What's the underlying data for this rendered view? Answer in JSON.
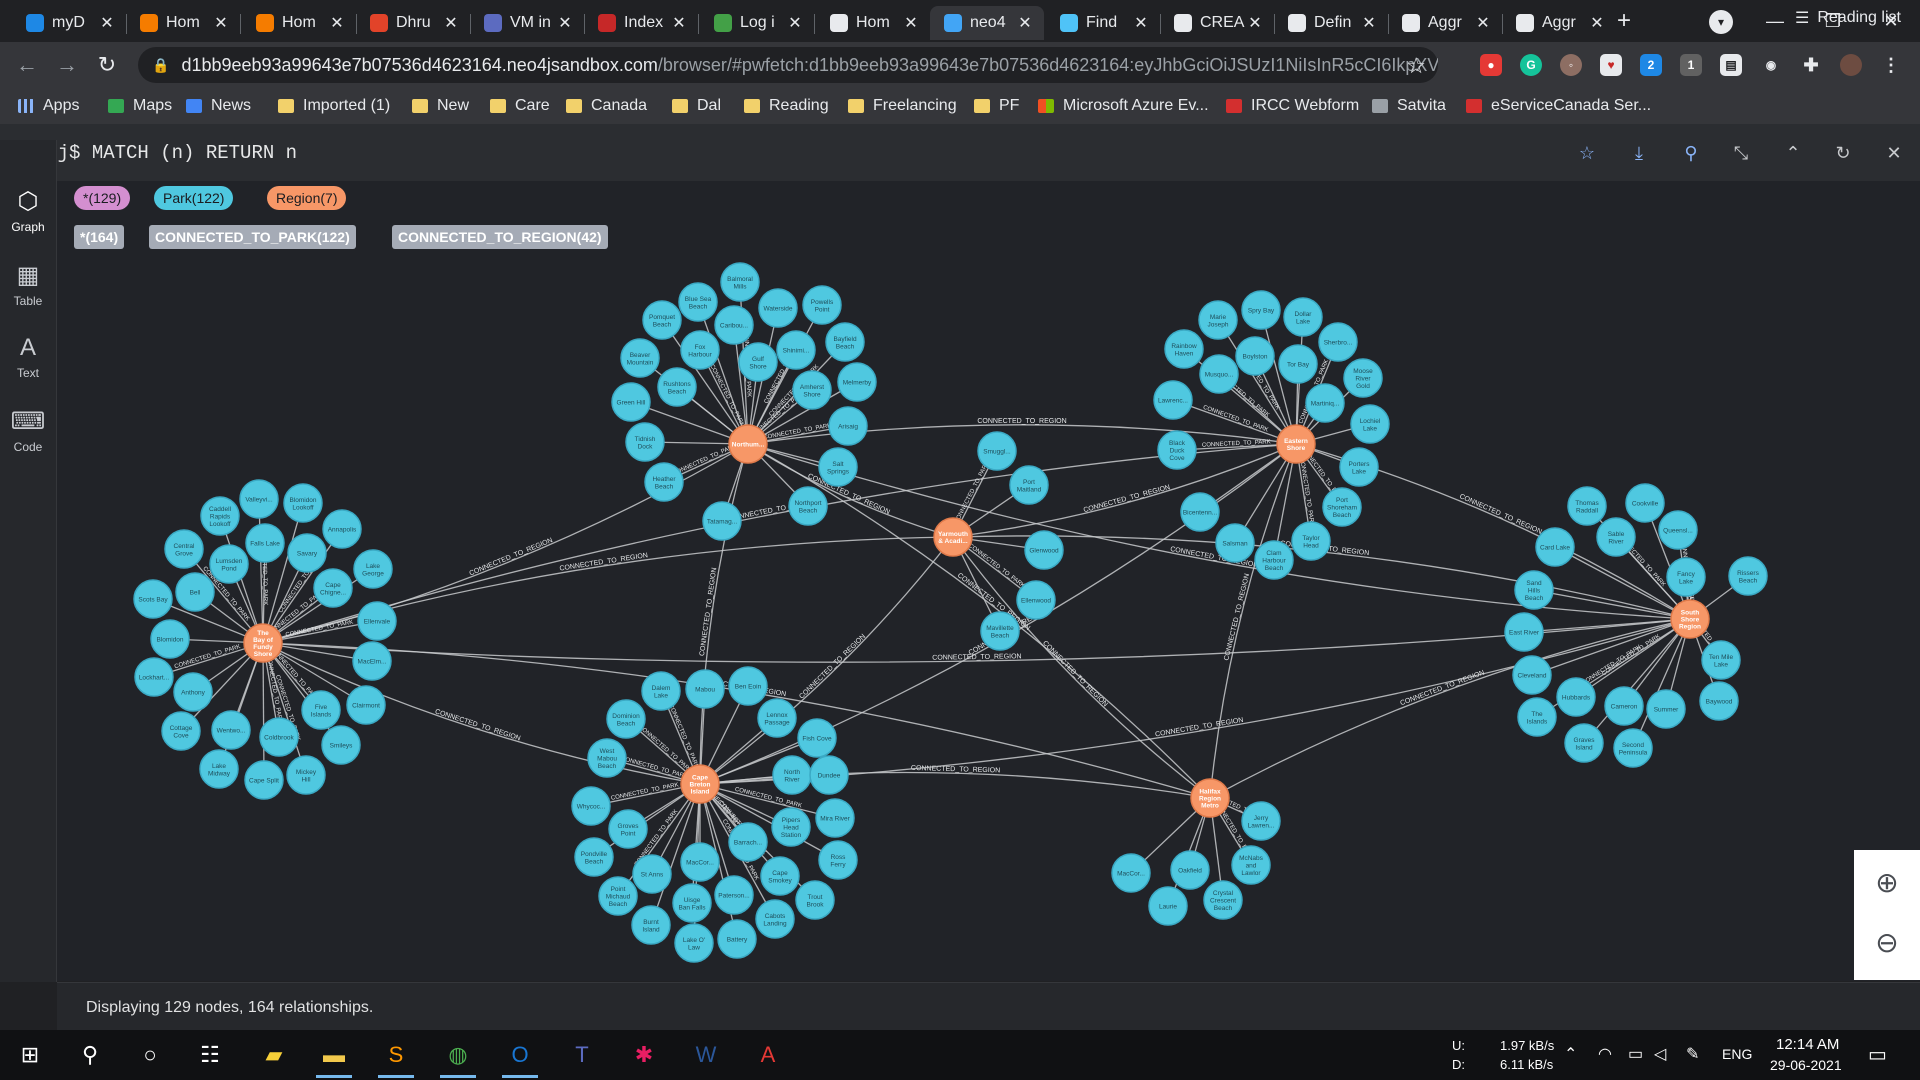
{
  "browser": {
    "tabs": [
      {
        "title": "myD",
        "icon": "snowflake-icon",
        "color": "#1e88e5",
        "active": false
      },
      {
        "title": "Hom",
        "icon": "blogger-icon",
        "color": "#f57c00",
        "active": false
      },
      {
        "title": "Hom",
        "icon": "blogger-icon",
        "color": "#f57c00",
        "active": false
      },
      {
        "title": "Dhru",
        "icon": "gitlab-icon",
        "color": "#e24329",
        "active": false
      },
      {
        "title": "VM in",
        "icon": "vm-icon",
        "color": "#5c6bc0",
        "active": false
      },
      {
        "title": "Index",
        "icon": "pen-icon",
        "color": "#c62828",
        "active": false
      },
      {
        "title": "Log i",
        "icon": "leaf-icon",
        "color": "#43a047",
        "active": false
      },
      {
        "title": "Hom",
        "icon": "neo4j-sandbox-icon",
        "color": "#e8eaed",
        "active": false
      },
      {
        "title": "neo4",
        "icon": "neo4j-browser-icon",
        "color": "#42a5f5",
        "active": true
      },
      {
        "title": "Find",
        "icon": "tool-icon",
        "color": "#4fc3f7",
        "active": false
      },
      {
        "title": "CREA",
        "icon": "neo4j-docs-icon",
        "color": "#e8eaed",
        "active": false
      },
      {
        "title": "Defin",
        "icon": "neo4j-docs-icon",
        "color": "#e8eaed",
        "active": false
      },
      {
        "title": "Aggr",
        "icon": "neo4j-docs-icon",
        "color": "#e8eaed",
        "active": false
      },
      {
        "title": "Aggr",
        "icon": "neo4j-docs-icon",
        "color": "#e8eaed",
        "active": false
      }
    ],
    "url_domain": "d1bb9eeb93a99643e7b07536d4623164.neo4jsandbox.com",
    "url_path": "/browser/#pwfetch:d1bb9eeb93a99643e7b07536d4623164:eyJhbGciOiJSUzI1NiIsInR5cCI6IkpXVCIsI...",
    "bookmarks": [
      {
        "label": "Apps",
        "icon": "apps-grid-icon"
      },
      {
        "label": "Maps",
        "icon": "maps-icon"
      },
      {
        "label": "News",
        "icon": "news-icon"
      },
      {
        "label": "Imported (1)",
        "icon": "folder-icon"
      },
      {
        "label": "New",
        "icon": "folder-icon"
      },
      {
        "label": "Care",
        "icon": "folder-icon"
      },
      {
        "label": "Canada",
        "icon": "folder-icon"
      },
      {
        "label": "Dal",
        "icon": "folder-icon"
      },
      {
        "label": "Reading",
        "icon": "folder-icon"
      },
      {
        "label": "Freelancing",
        "icon": "folder-icon"
      },
      {
        "label": "PF",
        "icon": "folder-icon"
      },
      {
        "label": "Microsoft Azure Ev...",
        "icon": "microsoft-icon"
      },
      {
        "label": "IRCC Webform",
        "icon": "maple-leaf-icon"
      },
      {
        "label": "Satvita",
        "icon": "globe-icon"
      },
      {
        "label": "eServiceCanada Ser...",
        "icon": "maple-leaf-icon"
      }
    ],
    "reading_list": "Reading list"
  },
  "neo4j": {
    "prompt": "neo4j$",
    "query": "MATCH (n) RETURN n",
    "sidebar": [
      {
        "label": "Graph",
        "icon": "graph-icon"
      },
      {
        "label": "Table",
        "icon": "table-icon"
      },
      {
        "label": "Text",
        "icon": "text-icon"
      },
      {
        "label": "Code",
        "icon": "code-icon"
      }
    ],
    "node_labels": [
      {
        "text": "*(129)",
        "color": "#d48fd0"
      },
      {
        "text": "Park(122)",
        "color": "#4fc8e0"
      },
      {
        "text": "Region(7)",
        "color": "#f79767"
      }
    ],
    "rel_types": [
      "*(164)",
      "CONNECTED_TO_PARK(122)",
      "CONNECTED_TO_REGION(42)"
    ],
    "status": "Displaying 129 nodes, 164 relationships.",
    "colors": {
      "park": "#4fc8e0",
      "region": "#f79767",
      "edge": "#c8cacd"
    }
  },
  "graph": {
    "park_rel_label": "CONNECTED_TO_PARK",
    "region_rel_label": "CONNECTED_TO_REGION",
    "regions": [
      {
        "id": "northumberland",
        "label": [
          "Northum..."
        ],
        "parks": [
          [
            "Balmoral",
            "Mills"
          ],
          [
            "Blue Sea",
            "Beach"
          ],
          [
            "Waterside"
          ],
          [
            "Powells",
            "Point"
          ],
          [
            "Pomquet",
            "Beach"
          ],
          [
            "Caribou..."
          ],
          [
            "Fox",
            "Harbour"
          ],
          [
            "Gulf",
            "Shore"
          ],
          [
            "Shinimi..."
          ],
          [
            "Bayfield",
            "Beach"
          ],
          [
            "Beaver",
            "Mountain"
          ],
          [
            "Rushtons",
            "Beach"
          ],
          [
            "Amherst",
            "Shore"
          ],
          [
            "Melmerby"
          ],
          [
            "Green Hill"
          ],
          [
            "Arisaig"
          ],
          [
            "Tidnish",
            "Dock"
          ],
          [
            "Salt",
            "Springs"
          ],
          [
            "Heather",
            "Beach"
          ],
          [
            "Northport",
            "Beach"
          ],
          [
            "Tatamag..."
          ]
        ]
      },
      {
        "id": "eastern",
        "label": [
          "Eastern",
          "Shore"
        ],
        "parks": [
          [
            "Marie",
            "Joseph"
          ],
          [
            "Spry Bay"
          ],
          [
            "Dollar",
            "Lake"
          ],
          [
            "Rainbow",
            "Haven"
          ],
          [
            "Boylston"
          ],
          [
            "Tor Bay"
          ],
          [
            "Sherbro..."
          ],
          [
            "Musquo..."
          ],
          [
            "Moose",
            "River",
            "Gold"
          ],
          [
            "Lawrenc..."
          ],
          [
            "Martiniq..."
          ],
          [
            "Lochiel",
            "Lake"
          ],
          [
            "Black",
            "Duck",
            "Cove"
          ],
          [
            "Porters",
            "Lake"
          ],
          [
            "Bicentenn..."
          ],
          [
            "Port",
            "Shoreham",
            "Beach"
          ],
          [
            "Salsman"
          ],
          [
            "Clam",
            "Harbour",
            "Beach"
          ],
          [
            "Taylor",
            "Head"
          ]
        ]
      },
      {
        "id": "yarmouth",
        "label": [
          "Yarmouth",
          "& Acadi..."
        ],
        "parks": [
          [
            "Smuggl..."
          ],
          [
            "Port",
            "Maitland"
          ],
          [
            "Glenwood"
          ],
          [
            "Ellenwood"
          ],
          [
            "Mavillette",
            "Beach"
          ]
        ]
      },
      {
        "id": "bayoffundy",
        "label": [
          "The",
          "Bay of",
          "Fundy",
          "Shore"
        ],
        "parks": [
          [
            "Valleyvi..."
          ],
          [
            "Blomidon",
            "Lookoff"
          ],
          [
            "Caddell",
            "Rapids",
            "Lookoff"
          ],
          [
            "Annapolis"
          ],
          [
            "Falls Lake"
          ],
          [
            "Savary"
          ],
          [
            "Central",
            "Grove"
          ],
          [
            "Lumsden",
            "Pond"
          ],
          [
            "Lake",
            "George"
          ],
          [
            "Cape",
            "Chigne..."
          ],
          [
            "Bell"
          ],
          [
            "Scots Bay"
          ],
          [
            "Ellenvale"
          ],
          [
            "Blomidon"
          ],
          [
            "MacElm..."
          ],
          [
            "Lockhart..."
          ],
          [
            "Anthony"
          ],
          [
            "Clairmont"
          ],
          [
            "Five",
            "Islands"
          ],
          [
            "Cottage",
            "Cove"
          ],
          [
            "Wentwo..."
          ],
          [
            "Coldbrook"
          ],
          [
            "Smileys"
          ],
          [
            "Lake",
            "Midway"
          ],
          [
            "Mickey",
            "Hill"
          ],
          [
            "Cape Split"
          ]
        ]
      },
      {
        "id": "southshore",
        "label": [
          "South",
          "Shore",
          "Region"
        ],
        "parks": [
          [
            "Thomas",
            "Raddall"
          ],
          [
            "Cookville"
          ],
          [
            "Sable",
            "River"
          ],
          [
            "Queensl..."
          ],
          [
            "Card Lake"
          ],
          [
            "Rissers",
            "Beach"
          ],
          [
            "Fancy",
            "Lake"
          ],
          [
            "Sand",
            "Hills",
            "Beach"
          ],
          [
            "East River"
          ],
          [
            "Ten Mile",
            "Lake"
          ],
          [
            "Cleveland"
          ],
          [
            "Baywood"
          ],
          [
            "Hubbards"
          ],
          [
            "Cameron"
          ],
          [
            "Summer"
          ],
          [
            "The",
            "Islands"
          ],
          [
            "Graves",
            "Island"
          ],
          [
            "Second",
            "Peninsula"
          ]
        ]
      },
      {
        "id": "capebreton",
        "label": [
          "Cape",
          "Breton",
          "Island"
        ],
        "parks": [
          [
            "Dalem",
            "Lake"
          ],
          [
            "Mabou"
          ],
          [
            "Ben Eoin"
          ],
          [
            "Dominion",
            "Beach"
          ],
          [
            "Lennox",
            "Passage"
          ],
          [
            "Fish Cove"
          ],
          [
            "West",
            "Mabou",
            "Beach"
          ],
          [
            "North",
            "River"
          ],
          [
            "Dundee"
          ],
          [
            "Whycoc..."
          ],
          [
            "Groves",
            "Point"
          ],
          [
            "Pipers",
            "Head",
            "Station"
          ],
          [
            "Mira River"
          ],
          [
            "Pondville",
            "Beach"
          ],
          [
            "MacCor..."
          ],
          [
            "Barrach..."
          ],
          [
            "St Anns"
          ],
          [
            "Ross",
            "Ferry"
          ],
          [
            "Point",
            "Michaud",
            "Beach"
          ],
          [
            "Uisge",
            "Ban Falls"
          ],
          [
            "Paterson..."
          ],
          [
            "Cape",
            "Smokey"
          ],
          [
            "Trout",
            "Brook"
          ],
          [
            "Burnt",
            "Island"
          ],
          [
            "Cabots",
            "Landing"
          ],
          [
            "Lake O'",
            "Law"
          ],
          [
            "Battery"
          ]
        ]
      },
      {
        "id": "halifax",
        "label": [
          "Halifax",
          "Region",
          "Metro"
        ],
        "parks": [
          [
            "Jerry",
            "Lawren..."
          ],
          [
            "MacCor..."
          ],
          [
            "Oakfield"
          ],
          [
            "McNabs",
            "and",
            "Lawlor"
          ],
          [
            "Laurie"
          ],
          [
            "Crystal",
            "Crescent",
            "Beach"
          ]
        ]
      }
    ]
  },
  "taskbar": {
    "net_upload": "1.97 kB/s",
    "net_download": "6.11 kB/s",
    "net_u_label": "U:",
    "net_d_label": "D:",
    "lang": "ENG",
    "time": "12:14 AM",
    "date": "29-06-2021"
  }
}
